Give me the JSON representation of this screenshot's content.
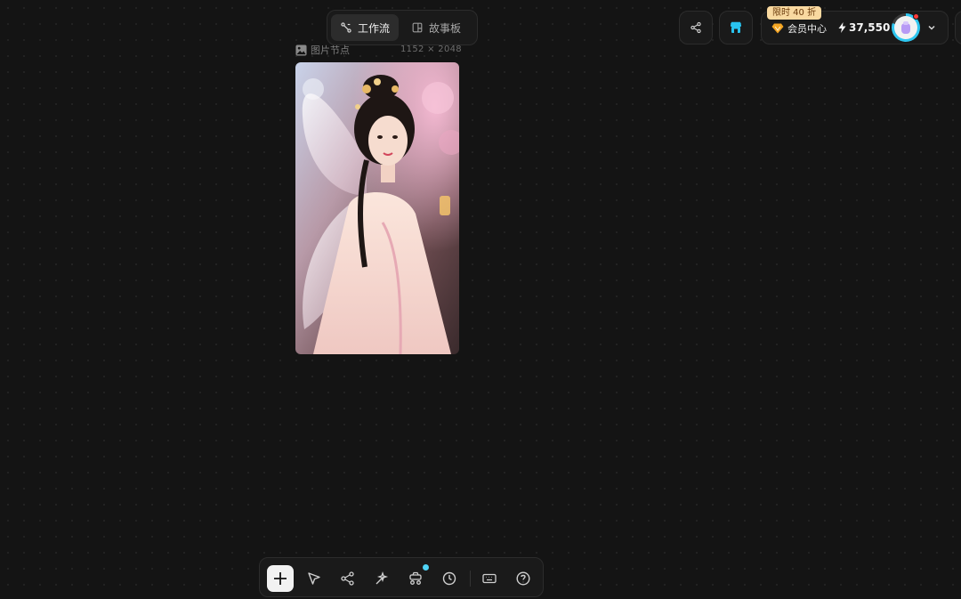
{
  "header": {
    "tabs": [
      {
        "label": "工作流",
        "active": true
      },
      {
        "label": "故事板",
        "active": false
      }
    ],
    "promo_badge": "限时 40 折",
    "member_center_label": "会员中心",
    "credits": "37,550"
  },
  "node": {
    "title": "图片节点",
    "dimensions": "1152 × 2048"
  },
  "toolbar": {
    "tools": [
      "add-icon",
      "pointer-icon",
      "workflow-icon",
      "magic-icon",
      "assets-icon",
      "history-icon",
      "keyboard-icon",
      "help-icon"
    ]
  },
  "colors": {
    "background": "#141414",
    "accent": "#2ec6f0",
    "promo": "#f9d9a0",
    "gem": "#f5a623"
  }
}
